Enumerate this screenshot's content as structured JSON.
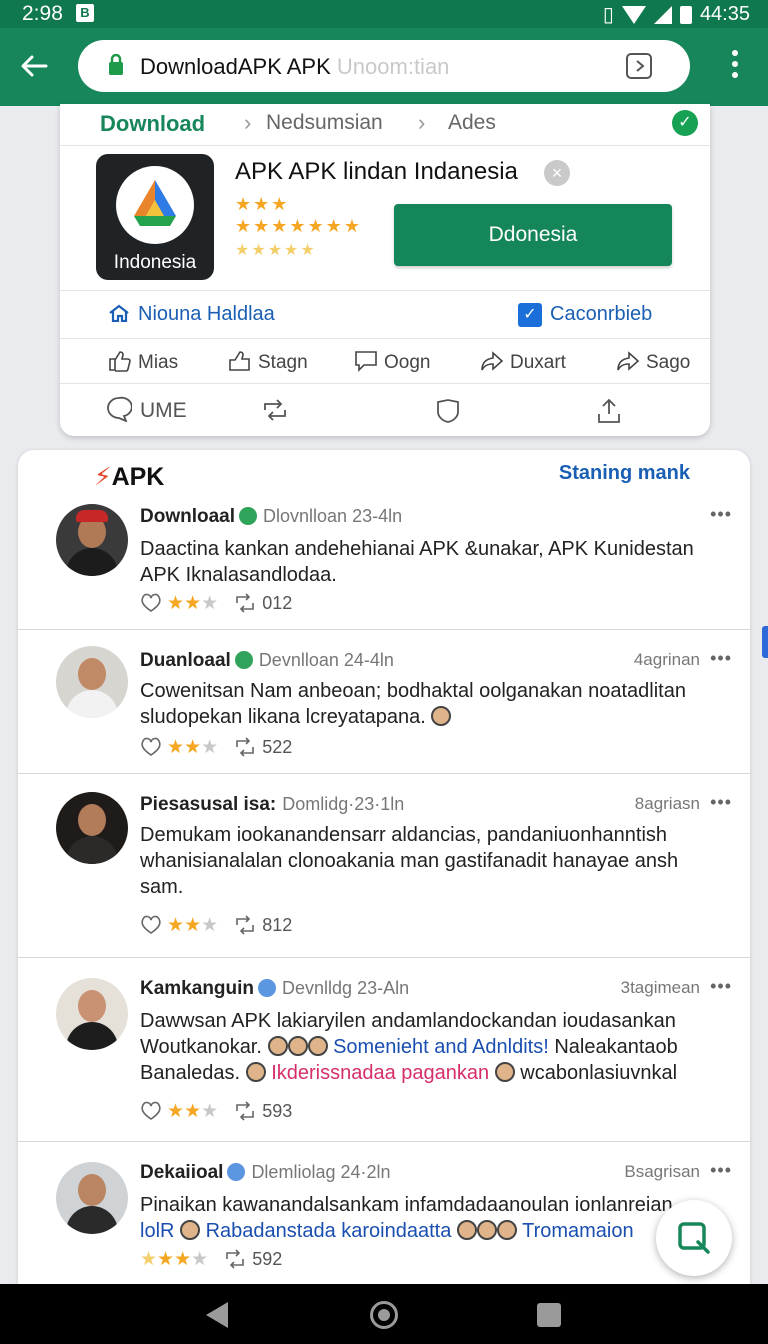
{
  "status_bar": {
    "time": "2:98",
    "right_text": "44:35"
  },
  "url_bar": {
    "url_main": "DownloadAPK APK",
    "url_faded": "Unoom:tian",
    "tab_count": ""
  },
  "breadcrumbs": [
    "Download",
    "Nedsumsian",
    "Ades"
  ],
  "app": {
    "icon_label": "Indonesia",
    "title": "APK APK lindan Indanesia",
    "stars_row1": "★★★",
    "stars_row2": "★★★★★★★",
    "stars_row3": "★★★★★",
    "install_button": "Ddonesia"
  },
  "links_row": {
    "home_link": "Niouna Haldlaa",
    "checkbox_label": "Caconrbieb"
  },
  "actions": [
    "Mias",
    "Stagn",
    "Oogn",
    "Duxart",
    "Sago"
  ],
  "bottom_row": {
    "label": "UME"
  },
  "feed": {
    "logo": "APK",
    "header_link": "Staning mank",
    "posts": [
      {
        "name": "Downloaal",
        "meta": "Dlovnlloan 23-4ln",
        "time": "",
        "text": "Daactina kankan andehehianai APK &unakar, APK Kunidestan APK Iknalasandlodaa.",
        "count": "012"
      },
      {
        "name": "Duanloaal",
        "meta": "Devnlloan 24-4ln",
        "time": "4agrinan",
        "text": "Cowenitsan Nam anbeoan; bodhaktal oolganakan noatadlitan sludopekan likana lcreyatapana.",
        "count": "522"
      },
      {
        "name": "Piesasusal isa:",
        "meta": "Domlidg·23·1ln",
        "time": "8agriasn",
        "text": "Demukam iookanandensarr aldancias, pandaniuonhanntish whanisianalalan clonoakania man gastifanadit hanayae ansh sam.",
        "count": "812"
      },
      {
        "name": "Kamkanguin",
        "meta": "Devnlldg 23-Aln",
        "time": "3tagimean",
        "text_a": "Dawwsan APK lakiaryilen andamlandockandan ioudasankan Woutkanokar.",
        "text_blue": "Somenieht and Adnldits!",
        "text_b": "Naleakantaob Banaledas.",
        "text_pink": "Ikderissnadaa pagankan",
        "text_c": "wcabonlasiuvnkal",
        "count": "593"
      },
      {
        "name": "Dekaiioal",
        "meta": "Dlemliolag 24·2ln",
        "time": "Bsagrisan",
        "text_a": "Pinaikan kawanandalsankam infamdadaanoulan ionlanreian",
        "text_blue_a": "lolR",
        "text_blue_b": "Rabadanstada karoindaatta",
        "text_blue_c": "Tromamaion",
        "count": "592"
      }
    ]
  },
  "colors": {
    "brand_green": "#17875b",
    "link_blue": "#1a5fb4",
    "star": "#f5a623"
  },
  "icons": [
    "back-arrow-icon",
    "lock-icon",
    "tabs-icon",
    "more-icon",
    "verified-icon",
    "home-icon",
    "checkbox-icon",
    "like-icon",
    "share-icon",
    "comment-icon",
    "forward-icon",
    "send-icon",
    "chat-icon",
    "repost-icon",
    "shield-icon",
    "upload-icon",
    "heart-icon",
    "retweet-icon",
    "compose-icon"
  ]
}
